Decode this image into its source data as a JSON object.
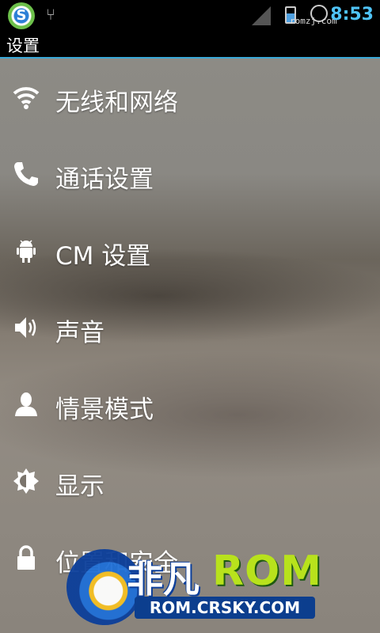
{
  "status_bar": {
    "time": "8:53",
    "watermark": "romzj.com"
  },
  "header": {
    "title": "设置"
  },
  "menu": [
    {
      "label": "无线和网络",
      "icon": "wifi-icon"
    },
    {
      "label": "通话设置",
      "icon": "phone-icon"
    },
    {
      "label": "CM 设置",
      "icon": "android-icon"
    },
    {
      "label": "声音",
      "icon": "speaker-icon"
    },
    {
      "label": "情景模式",
      "icon": "person-icon"
    },
    {
      "label": "显示",
      "icon": "brightness-icon"
    },
    {
      "label": "位置和安全",
      "icon": "lock-icon"
    }
  ],
  "logo": {
    "cn_text": "非凡",
    "brand_text": "ROM",
    "url_text": "ROM.CRSKY.COM"
  },
  "colors": {
    "accent": "#3aa7d6",
    "time": "#4fc3f7"
  }
}
